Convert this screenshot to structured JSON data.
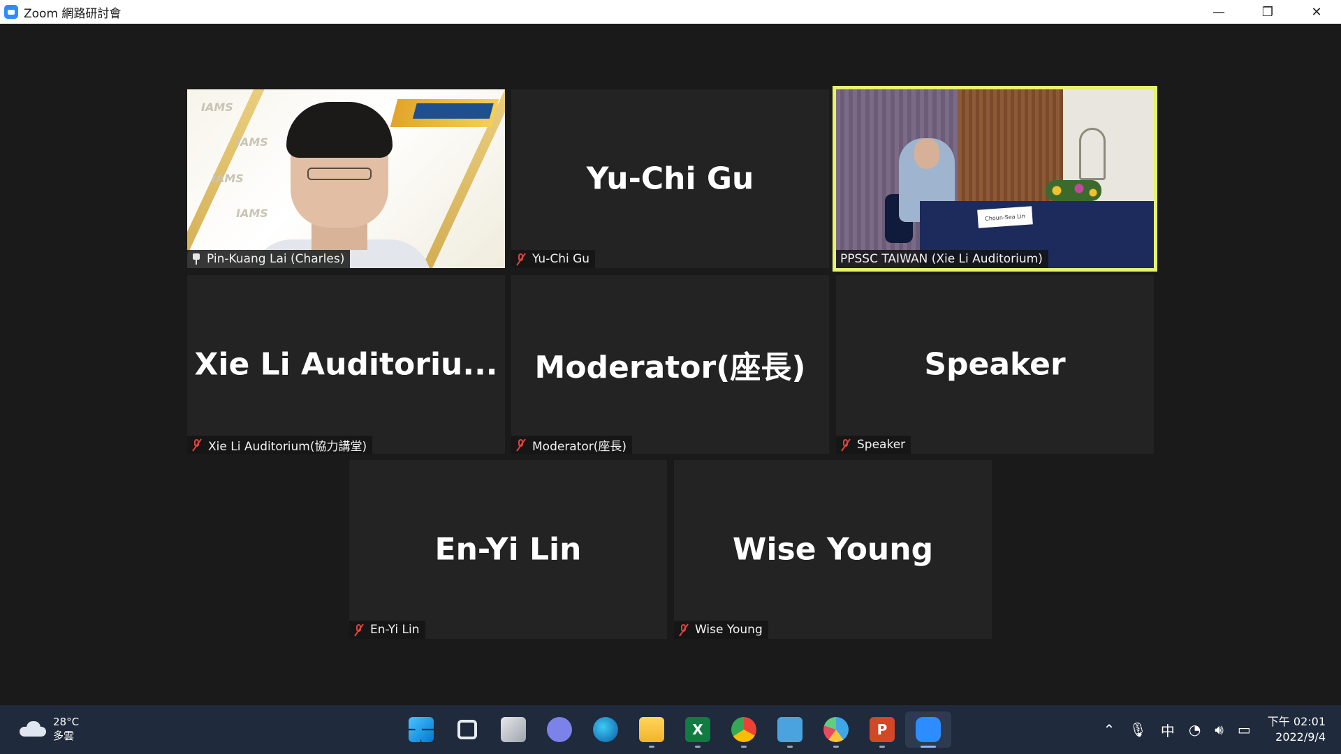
{
  "window": {
    "title": "Zoom 網路研討會",
    "controls": [
      "minimize",
      "restore",
      "close"
    ]
  },
  "participants": [
    {
      "display": "",
      "label": "Pin-Kuang Lai (Charles)",
      "video": true,
      "pinned": true,
      "muted": false,
      "active_speaker": false
    },
    {
      "display": "Yu-Chi Gu",
      "label": "Yu-Chi Gu",
      "video": false,
      "muted": true
    },
    {
      "display": "",
      "label": "PPSSC TAIWAN (Xie Li Auditorium)",
      "video": true,
      "muted": false,
      "active_speaker": true,
      "nameplate": "Choun-Sea Lin"
    },
    {
      "display": "Xie  Li  Auditoriu...",
      "label": "Xie Li Auditorium(協力講堂)",
      "video": false,
      "muted": true
    },
    {
      "display": "Moderator(座長)",
      "label": "Moderator(座長)",
      "video": false,
      "muted": true
    },
    {
      "display": "Speaker",
      "label": "Speaker",
      "video": false,
      "muted": true
    },
    {
      "display": "En-Yi Lin",
      "label": "En-Yi Lin",
      "video": false,
      "muted": true
    },
    {
      "display": "Wise Young",
      "label": "Wise Young",
      "video": false,
      "muted": true
    }
  ],
  "taskbar": {
    "weather": {
      "temp": "28°C",
      "condition": "多雲"
    },
    "apps": [
      "start",
      "search",
      "task-view",
      "chat",
      "edge",
      "file-explorer",
      "excel",
      "chrome",
      "notepad",
      "paint",
      "powerpoint",
      "zoom"
    ],
    "ime": "中",
    "clock": {
      "time": "下午 02:01",
      "date": "2022/9/4"
    }
  },
  "colors": {
    "active_speaker_border": "#e8f26b",
    "muted_icon": "#e0443e",
    "tile_bg": "#232323",
    "taskbar_bg": "#1f2a3c"
  }
}
